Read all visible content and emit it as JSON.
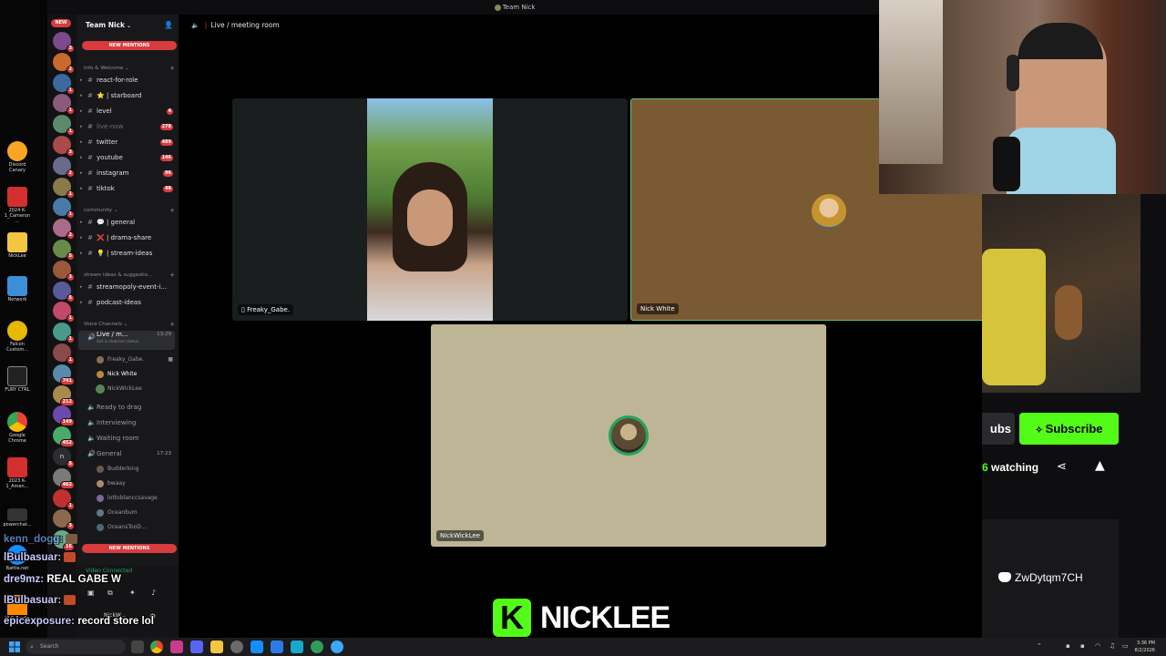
{
  "window": {
    "title": "Team Nick"
  },
  "desktop": {
    "icons": [
      {
        "label": "Discord Canary",
        "color": "#f6a623"
      },
      {
        "label": "2024 K-1_Cameron ...",
        "color": "#d32f2f"
      },
      {
        "label": "NickLee",
        "color": "#f4c542"
      },
      {
        "label": "Network",
        "color": "#3a8fd8"
      },
      {
        "label": "Falcon Custom...",
        "color": "#e6b800"
      },
      {
        "label": "FURY CTRL",
        "color": "#222222"
      },
      {
        "label": "Google Chrome",
        "color": "#34a853"
      },
      {
        "label": "2023 K-1_Amen...",
        "color": "#d32f2f"
      },
      {
        "label": "powerchat...",
        "color": "#333333"
      },
      {
        "label": "Battle.net",
        "color": "#148eff"
      },
      {
        "label": "VLC media",
        "color": "#ff8800"
      }
    ]
  },
  "guilds": {
    "new_label": "NEW",
    "badges": [
      "3",
      "2",
      "1",
      "1",
      "1",
      "3",
      "2",
      "1",
      "1",
      "2",
      "5",
      "3",
      "5",
      "1",
      "1",
      "1",
      "741",
      "212",
      "149",
      "452",
      "5",
      "462",
      "1",
      "3",
      "16"
    ]
  },
  "sidebar": {
    "server_name": "Team Nick",
    "new_mentions": "NEW MENTIONS",
    "categories": {
      "info": "Info & Welcome",
      "community": "community",
      "stream": "stream ideas & suggestio...",
      "voice": "Voice Channels"
    },
    "channels": [
      {
        "name": "react-for-role",
        "count": ""
      },
      {
        "name": "⭐ | starboard",
        "count": ""
      },
      {
        "name": "level",
        "count": "4"
      },
      {
        "name": "live-now",
        "count": "278"
      },
      {
        "name": "twitter",
        "count": "489"
      },
      {
        "name": "youtube",
        "count": "146"
      },
      {
        "name": "instagram",
        "count": "96"
      },
      {
        "name": "tiktok",
        "count": "48"
      },
      {
        "name": "💬 | general",
        "count": ""
      },
      {
        "name": "❌ | drama-share",
        "count": ""
      },
      {
        "name": "💡 | stream-ideas",
        "count": ""
      },
      {
        "name": "streamopoly-event-i...",
        "count": ""
      },
      {
        "name": "podcast-ideas",
        "count": ""
      }
    ],
    "voice": {
      "live_channel": "Live / m...",
      "live_time": "13:29",
      "live_status": "Set a channel status",
      "live_users": [
        "Freaky_Gabe.",
        "Nick White",
        "NickWickLee"
      ],
      "ready": "Ready to drag",
      "interviewing": "Interviewing",
      "waiting": "Waiting room",
      "general": "General",
      "general_time": "17:23",
      "general_users": [
        "Budderking",
        "bwaay",
        "lottoblanccsavage",
        "Oceanbum",
        "OceansTooD..."
      ]
    },
    "vc_status": "Video Connected",
    "user": "NickW..."
  },
  "main": {
    "header": "Live / meeting room",
    "tiles": [
      {
        "label": "Freaky_Gabe."
      },
      {
        "label": "Nick White"
      },
      {
        "label": "NickWickLee"
      }
    ]
  },
  "twitch": {
    "subs_label": "ubs",
    "subscribe_label": "Subscribe",
    "watching_count": "6",
    "watching_label": "watching",
    "discord_code": "ZwDytqm7CH"
  },
  "chat": [
    {
      "user": "kenn_dogg:",
      "msg": ""
    },
    {
      "user": "lBulbasuar:",
      "msg": ""
    },
    {
      "user": "dre9mz:",
      "msg": "REAL GABE W"
    },
    {
      "user": "lBulbasuar:",
      "msg": ""
    },
    {
      "user": "epicexposure:",
      "msg": "record store lol"
    }
  ],
  "overlay": {
    "brand_letter": "K",
    "brand_name": "NICKLEE"
  },
  "taskbar": {
    "search": "Search",
    "time": "3:36 PM",
    "date": "8/2/2026"
  },
  "colors": {
    "kick_green": "#53fc18",
    "discord_red": "#d83c3e",
    "tile_brown": "#7a5a33",
    "tile_tan": "#bdb596",
    "tile_dark": "#1a1e1f"
  }
}
